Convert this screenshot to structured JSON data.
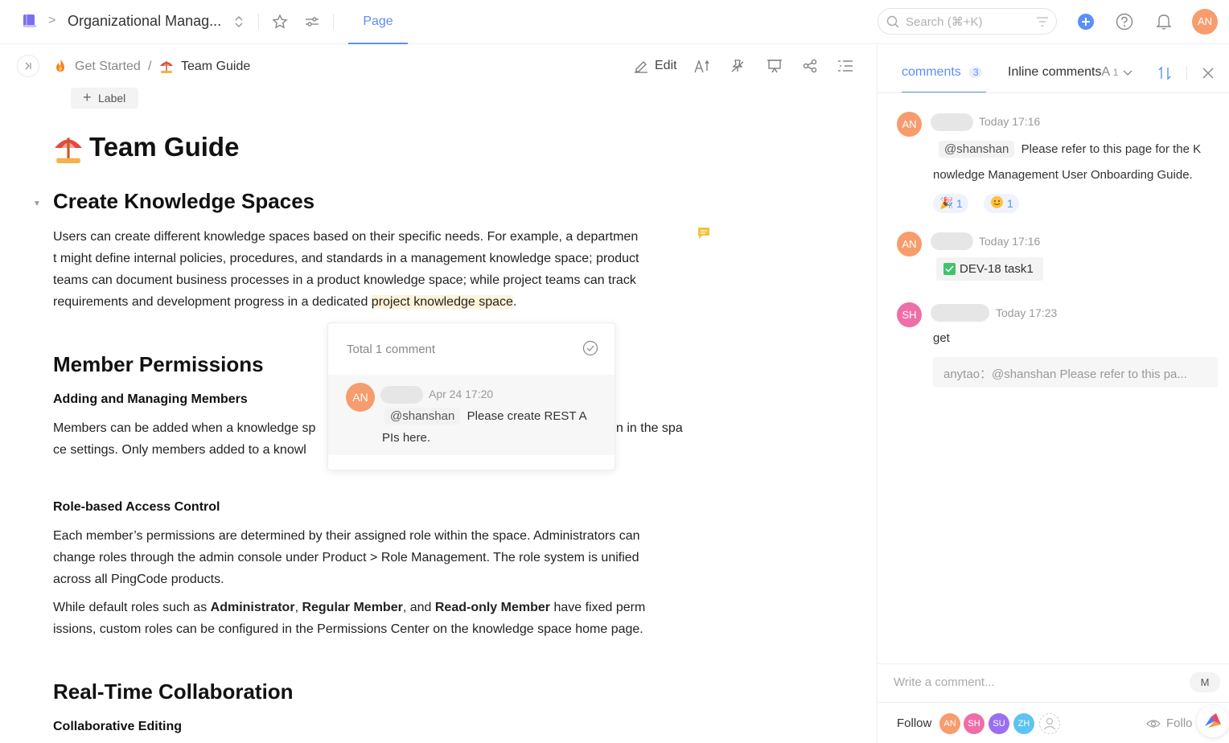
{
  "topbar": {
    "workspace_name": "Organizational Manag...",
    "tab_page": "Page",
    "search_placeholder": "Search (⌘+K)",
    "user_initials": "AN"
  },
  "doc_header": {
    "breadcrumb": [
      "Get Started",
      "/",
      "Team Guide"
    ],
    "edit_label": "Edit",
    "label_button": "Label"
  },
  "doc": {
    "title": "Team Guide",
    "sections": {
      "s1_title": "Create Knowledge Spaces",
      "s1_lines": [
        "Users can create different knowledge spaces based on their specific needs. For example, a departmen",
        "t might define internal policies, procedures, and standards in a management knowledge space; product",
        "teams can document business processes in a product knowledge space; while project teams can track"
      ],
      "s1_last_prefix": "requirements and development progress in a dedicated ",
      "s1_last_highlight": "project knowledge space",
      "s1_last_suffix": ".",
      "s2_title": "Member Permissions",
      "s2_sub1": "Adding and Managing Members",
      "s2_p1_line1_a": "Members can be added when a knowledge sp",
      "s2_p1_line1_b": "n in the spa",
      "s2_p1_line2": "ce settings. Only members added to a knowl",
      "s2_sub2": "Role-based Access Control",
      "s2_p2_lines": [
        "Each member’s permissions are determined by their assigned role within the space. Administrators can",
        "change roles through the admin console under Product > Role Management. The role system is unified",
        "across all PingCode products."
      ],
      "s2_p3_l1_a": "While default roles such as ",
      "s2_p3_l1_b": "Administrator",
      "s2_p3_l1_c": ", ",
      "s2_p3_l1_d": "Regular Member",
      "s2_p3_l1_e": ", and ",
      "s2_p3_l1_f": "Read-only Member",
      "s2_p3_l1_g": " have fixed perm",
      "s2_p3_l2": "issions, custom roles can be configured in the Permissions Center on the knowledge space home page.",
      "s3_title": "Real-Time Collaboration",
      "s3_sub1": "Collaborative Editing"
    }
  },
  "popup": {
    "title": "Total 1 comment",
    "avatar": "AN",
    "time": "Apr 24 17:20",
    "mention": "@shanshan",
    "text_line1": "Please create REST A",
    "text_line2": "PIs here."
  },
  "panel": {
    "tab_comments": "comments",
    "tab_comments_count": "3",
    "tab_inline": "Inline comments",
    "tab_inline_a": "A",
    "tab_inline_count": "1",
    "comments": [
      {
        "avatar": "AN",
        "time": "Today 17:16",
        "mention": "@shanshan",
        "text_line1": "Please refer to this page for the K",
        "text_line2": "nowledge Management User Onboarding Guide.",
        "reaction1_count": "1",
        "reaction2_count": "1"
      },
      {
        "avatar": "AN",
        "time": "Today 17:16",
        "work_item": "DEV-18 task1"
      },
      {
        "avatar": "SH",
        "time": "Today 17:23",
        "text": "get",
        "quote": "anytao：@shanshan Please refer to this pa..."
      }
    ],
    "input_placeholder": "Write a comment...",
    "input_badge": "M",
    "follow_label": "Follow",
    "followers": [
      "AN",
      "SH",
      "SU",
      "ZH"
    ],
    "follow_action": "Follo"
  },
  "colors": {
    "accent": "#5b8ff9",
    "avatar_an": "#f79c6d",
    "avatar_sh": "#ee6fa8",
    "avatar_su": "#9a6ff0",
    "avatar_zh": "#5cc3f2",
    "highlight": "#fdf3d9",
    "comment_marker": "#f5c13e"
  }
}
